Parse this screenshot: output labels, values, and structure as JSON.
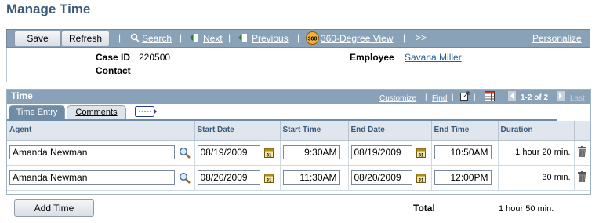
{
  "page": {
    "title": "Manage Time"
  },
  "toolbar": {
    "save_label": "Save",
    "refresh_label": "Refresh",
    "search_label": "Search",
    "next_label": "Next",
    "previous_label": "Previous",
    "degree_label": "360-Degree View",
    "more_label": ">>",
    "personalize_label": "Personalize"
  },
  "header": {
    "case_id_label": "Case ID",
    "case_id_value": "220500",
    "contact_label": "Contact",
    "employee_label": "Employee",
    "employee_value": "Savana Miller"
  },
  "grid": {
    "title": "Time",
    "customize_label": "Customize",
    "find_label": "Find",
    "paging_label": "1-2 of 2",
    "last_label": "Last",
    "tabs": [
      {
        "label": "Time Entry"
      },
      {
        "label": "Comments"
      }
    ],
    "columns": [
      "Agent",
      "Start Date",
      "Start Time",
      "End Date",
      "End Time",
      "Duration"
    ],
    "rows": [
      {
        "agent": "Amanda Newman",
        "start_date": "08/19/2009",
        "start_time": "9:30AM",
        "end_date": "08/19/2009",
        "end_time": "10:50AM",
        "duration": "1 hour 20 min."
      },
      {
        "agent": "Amanda Newman",
        "start_date": "08/20/2009",
        "start_time": "11:30AM",
        "end_date": "08/20/2009",
        "end_time": "12:00PM",
        "duration": "30 min."
      }
    ]
  },
  "footer": {
    "add_time_label": "Add Time",
    "total_label": "Total",
    "total_value": "1 hour 50 min."
  }
}
